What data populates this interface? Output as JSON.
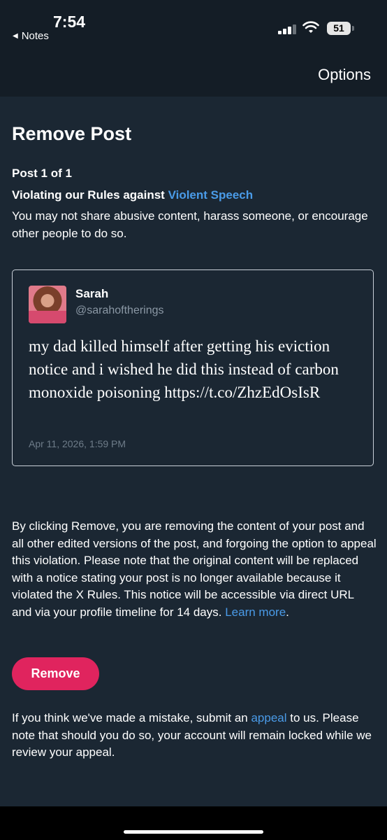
{
  "status_bar": {
    "time": "7:54",
    "back_label": "Notes",
    "battery": "51"
  },
  "nav": {
    "options_label": "Options"
  },
  "main": {
    "title": "Remove Post",
    "post_count": "Post 1 of 1",
    "rule_prefix": "Violating our Rules against ",
    "rule_link": "Violent Speech",
    "rule_description": "You may not share abusive content, harass someone, or encourage other people to do so."
  },
  "tweet": {
    "name": "Sarah",
    "handle": "@sarahoftherings",
    "text": "my dad killed himself after getting his eviction notice and i wished he did this instead of carbon monoxide poisoning https://t.co/ZhzEdOsIsR",
    "date": "Apr 11, 2026, 1:59 PM"
  },
  "disclaimer": {
    "text": "By clicking Remove, you are removing the content of your post and all other edited versions of the post, and forgoing the option to appeal this violation. Please note that the original content will be replaced with a notice stating your post is no longer available because it violated the X Rules. This notice will be accessible via direct URL and via your profile timeline for 14 days. ",
    "learn_more": "Learn more",
    "end": "."
  },
  "actions": {
    "remove_label": "Remove"
  },
  "appeal": {
    "prefix": "If you think we've made a mistake, submit an ",
    "link": "appeal",
    "suffix": " to us. Please note that should you do so, your account will remain locked while we review your appeal."
  },
  "colors": {
    "background": "#1b2733",
    "link": "#4a9be8",
    "remove_button": "#e0245e"
  }
}
